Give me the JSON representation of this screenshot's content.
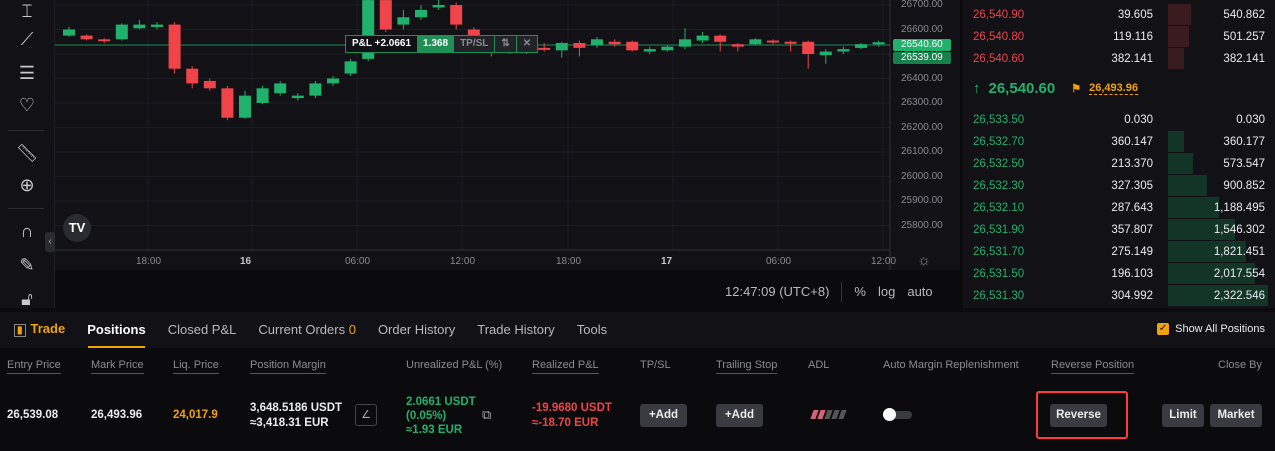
{
  "colors": {
    "up": "#20b26c",
    "down": "#ef454a",
    "accent": "#f0a30a",
    "highlight": "#ff3b3b"
  },
  "toolbar": {
    "icons": [
      "cursor-icon",
      "trend-line-icon",
      "indicator-settings-icon",
      "favorite-heart-icon",
      "ruler-icon",
      "zoom-in-icon",
      "magnet-icon",
      "draw-lock-icon",
      "lock-icon"
    ]
  },
  "chart": {
    "price_axis": [
      "26700.00",
      "26600.00",
      "26500.00",
      "26400.00",
      "26300.00",
      "26200.00",
      "26100.00",
      "26000.00",
      "25900.00",
      "25800.00"
    ],
    "time_axis": [
      {
        "label": "18:00",
        "bold": false
      },
      {
        "label": "16",
        "bold": true
      },
      {
        "label": "06:00",
        "bold": false
      },
      {
        "label": "12:00",
        "bold": false
      },
      {
        "label": "18:00",
        "bold": false
      },
      {
        "label": "17",
        "bold": true
      },
      {
        "label": "06:00",
        "bold": false
      },
      {
        "label": "12:00",
        "bold": false
      }
    ],
    "last_price_tag": "26540.60",
    "entry_price_tag": "26539.09",
    "position_line": {
      "pnl": "P&L +2.0661",
      "qty": "1.368",
      "tpsl": "TP/SL"
    },
    "clock": "12:47:09 (UTC+8)",
    "scale_options": [
      "%",
      "log",
      "auto"
    ],
    "candles": [
      [
        26575,
        26600,
        26610,
        26570
      ],
      [
        26575,
        26560,
        26580,
        26555
      ],
      [
        26560,
        26555,
        26565,
        26545
      ],
      [
        26560,
        26620,
        26625,
        26555
      ],
      [
        26605,
        26620,
        26640,
        26600
      ],
      [
        26610,
        26620,
        26630,
        26600
      ],
      [
        26620,
        26440,
        26630,
        26420
      ],
      [
        26440,
        26380,
        26450,
        26360
      ],
      [
        26390,
        26360,
        26400,
        26350
      ],
      [
        26360,
        26240,
        26370,
        26230
      ],
      [
        26240,
        26330,
        26350,
        26235
      ],
      [
        26300,
        26360,
        26370,
        26295
      ],
      [
        26340,
        26380,
        26390,
        26330
      ],
      [
        26320,
        26330,
        26340,
        26310
      ],
      [
        26330,
        26380,
        26390,
        26320
      ],
      [
        26380,
        26400,
        26410,
        26370
      ],
      [
        26420,
        26470,
        26480,
        26410
      ],
      [
        26480,
        26720,
        26750,
        26470
      ],
      [
        26720,
        26600,
        26740,
        26590
      ],
      [
        26620,
        26650,
        26680,
        26600
      ],
      [
        26650,
        26680,
        26700,
        26640
      ],
      [
        26690,
        26700,
        26740,
        26680
      ],
      [
        26700,
        26620,
        26710,
        26600
      ],
      [
        26600,
        26560,
        26610,
        26550
      ],
      [
        26525,
        26505,
        26535,
        26490
      ],
      [
        26510,
        26520,
        26530,
        26500
      ],
      [
        26515,
        26525,
        26545,
        26500
      ],
      [
        26525,
        26520,
        26545,
        26510
      ],
      [
        26515,
        26545,
        26550,
        26485
      ],
      [
        26545,
        26525,
        26555,
        26490
      ],
      [
        26535,
        26560,
        26570,
        26525
      ],
      [
        26550,
        26540,
        26560,
        26530
      ],
      [
        26550,
        26515,
        26555,
        26510
      ],
      [
        26510,
        26520,
        26530,
        26500
      ],
      [
        26515,
        26530,
        26535,
        26510
      ],
      [
        26530,
        26560,
        26605,
        26520
      ],
      [
        26555,
        26575,
        26590,
        26545
      ],
      [
        26575,
        26550,
        26580,
        26510
      ],
      [
        26540,
        26530,
        26545,
        26510
      ],
      [
        26540,
        26560,
        26565,
        26535
      ],
      [
        26555,
        26550,
        26560,
        26540
      ],
      [
        26550,
        26548,
        26555,
        26510
      ],
      [
        26550,
        26500,
        26555,
        26440
      ],
      [
        26495,
        26510,
        26520,
        26460
      ],
      [
        26510,
        26520,
        26530,
        26500
      ],
      [
        26525,
        26540,
        26545,
        26520
      ],
      [
        26540,
        26548,
        26555,
        26530
      ]
    ]
  },
  "orderbook": {
    "asks": [
      {
        "price": "26,540.90",
        "qty": "39.605",
        "total": "540.862",
        "depth": 0.23
      },
      {
        "price": "26,540.80",
        "qty": "119.116",
        "total": "501.257",
        "depth": 0.21
      },
      {
        "price": "26,540.60",
        "qty": "382.141",
        "total": "382.141",
        "depth": 0.16
      }
    ],
    "last_price": "26,540.60",
    "mark_price": "26,493.96",
    "bids": [
      {
        "price": "26,533.50",
        "qty": "0.030",
        "total": "0.030",
        "depth": 0
      },
      {
        "price": "26,532.70",
        "qty": "360.147",
        "total": "360.177",
        "depth": 0.16
      },
      {
        "price": "26,532.50",
        "qty": "213.370",
        "total": "573.547",
        "depth": 0.25
      },
      {
        "price": "26,532.30",
        "qty": "327.305",
        "total": "900.852",
        "depth": 0.39
      },
      {
        "price": "26,532.10",
        "qty": "287.643",
        "total": "1,188.495",
        "depth": 0.51
      },
      {
        "price": "26,531.90",
        "qty": "357.807",
        "total": "1,546.302",
        "depth": 0.67
      },
      {
        "price": "26,531.70",
        "qty": "275.149",
        "total": "1,821.451",
        "depth": 0.78
      },
      {
        "price": "26,531.50",
        "qty": "196.103",
        "total": "2,017.554",
        "depth": 0.87
      },
      {
        "price": "26,531.30",
        "qty": "304.992",
        "total": "2,322.546",
        "depth": 1.0
      }
    ]
  },
  "tabs": {
    "trade": "Trade",
    "items": [
      "Positions",
      "Closed P&L",
      "Current Orders",
      "Order History",
      "Trade History",
      "Tools"
    ],
    "current_orders_count": "0",
    "show_all": "Show All Positions"
  },
  "positions": {
    "headers": [
      "Entry Price",
      "Mark Price",
      "Liq. Price",
      "Position Margin",
      "Unrealized P&L (%)",
      "Realized P&L",
      "TP/SL",
      "Trailing Stop",
      "ADL",
      "Auto Margin Replenishment",
      "Reverse Position",
      "Close By"
    ],
    "row": {
      "entry": "26,539.08",
      "mark": "26,493.96",
      "liq": "24,017.9",
      "margin_usdt": "3,648.5186 USDT",
      "margin_eur": "≈3,418.31 EUR",
      "upnl_usdt": "2.0661 USDT",
      "upnl_pct": "(0.05%)",
      "upnl_eur": "≈1.93 EUR",
      "rpnl_usdt": "-19.9680 USDT",
      "rpnl_eur": "≈-18.70 EUR",
      "tpsl_btn": "+Add",
      "trailing_btn": "+Add",
      "adl_level": 2,
      "adl_max": 5,
      "auto_margin": false,
      "reverse_btn": "Reverse",
      "limit_btn": "Limit",
      "market_btn": "Market"
    }
  }
}
